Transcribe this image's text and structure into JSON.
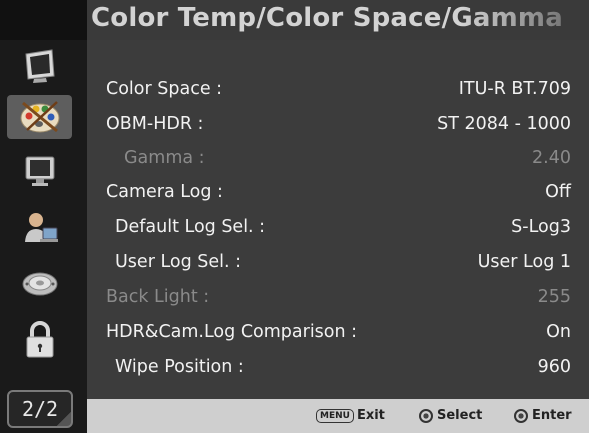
{
  "header": {
    "title": "Color Temp/Color Space/Gamma"
  },
  "sidebar": {
    "items": [
      {
        "name": "display-icon",
        "active": false
      },
      {
        "name": "palette-icon",
        "active": true
      },
      {
        "name": "monitor-icon",
        "active": false
      },
      {
        "name": "user-icon",
        "active": false
      },
      {
        "name": "dial-icon",
        "active": false
      },
      {
        "name": "lock-icon",
        "active": false
      }
    ],
    "page_indicator": "2/2"
  },
  "settings": [
    {
      "label": "Color Space :",
      "value": "ITU-R BT.709",
      "enabled": true
    },
    {
      "label": "OBM-HDR :",
      "value": "ST 2084 - 1000",
      "enabled": true
    },
    {
      "label": "Gamma :",
      "value": "2.40",
      "enabled": false
    },
    {
      "label": "Camera Log :",
      "value": "Off",
      "enabled": true
    },
    {
      "label": "Default Log Sel. :",
      "value": "S-Log3",
      "enabled": true
    },
    {
      "label": "User Log Sel. :",
      "value": "User Log 1",
      "enabled": true
    },
    {
      "label": "Back Light :",
      "value": "255",
      "enabled": false
    },
    {
      "label": "HDR&Cam.Log Comparison :",
      "value": "On",
      "enabled": true
    },
    {
      "label": "Wipe Position :",
      "value": "960",
      "enabled": true
    }
  ],
  "footer": {
    "menu_key": "MENU",
    "exit_label": "Exit",
    "select_label": "Select",
    "enter_label": "Enter"
  },
  "colors": {
    "content_bg": "#3c3c3c",
    "sidebar_bg": "#1a1a1a",
    "active_item_bg": "#5e5e5e",
    "text": "#f2f2f2",
    "dim_text": "#8a8a8a",
    "footer_bg": "#cfcfcf"
  }
}
